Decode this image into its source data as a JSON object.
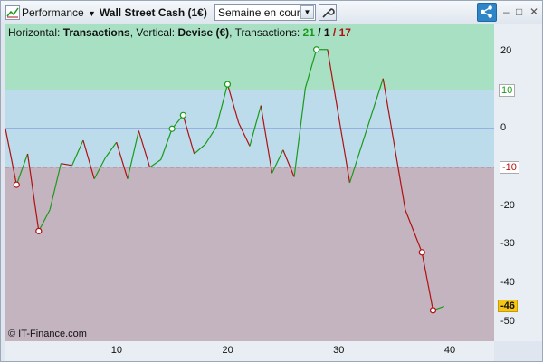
{
  "toolbar": {
    "performance_label": "Performance",
    "instrument": "Wall Street Cash (1€)",
    "period_value": "Semaine en cours",
    "window_controls": [
      "–",
      "□",
      "✕"
    ]
  },
  "legend": {
    "horizontal_prefix": "Horizontal:",
    "horizontal_value": "Transactions",
    "vertical_prefix": ", Vertical:",
    "vertical_value": "Devise (€)",
    "transactions_prefix": ", Transactions:",
    "wins": "21",
    "slash1": " / ",
    "neutral": "1",
    "slash2": " / ",
    "losses": "17"
  },
  "copyright": "© IT-Finance.com",
  "colors": {
    "green_zone": "#a8e0c4",
    "blue_zone": "#bcdcec",
    "red_zone": "#c4b4c0",
    "zero_line": "#2030c0",
    "up": "#1a9a1a",
    "down": "#b01010"
  },
  "chart_data": {
    "type": "line",
    "xlim": [
      0,
      44
    ],
    "ylim": [
      -55,
      27
    ],
    "x_ticks": [
      10,
      20,
      30,
      40
    ],
    "y_ticks": [
      20,
      10,
      0,
      -10,
      -20,
      -30,
      -40,
      -50
    ],
    "zones": {
      "upper": 10,
      "lower": -10
    },
    "current_value": -46,
    "points": [
      [
        0,
        0
      ],
      [
        1,
        -14.5
      ],
      [
        2,
        -6.5
      ],
      [
        3,
        -26.5
      ],
      [
        4,
        -21
      ],
      [
        5,
        -9
      ],
      [
        6,
        -9.5
      ],
      [
        7,
        -3
      ],
      [
        8,
        -13
      ],
      [
        9,
        -7.5
      ],
      [
        10,
        -3.5
      ],
      [
        11,
        -13
      ],
      [
        12,
        -0.5
      ],
      [
        13,
        -10
      ],
      [
        14,
        -8
      ],
      [
        15,
        0
      ],
      [
        16,
        3.5
      ],
      [
        17,
        -6.5
      ],
      [
        18,
        -4
      ],
      [
        19,
        0.5
      ],
      [
        20,
        11.5
      ],
      [
        21,
        1.5
      ],
      [
        22,
        -4.5
      ],
      [
        23,
        6
      ],
      [
        24,
        -11.5
      ],
      [
        25,
        -5.5
      ],
      [
        26,
        -12.5
      ],
      [
        27,
        10.5
      ],
      [
        28,
        20.5
      ],
      [
        29,
        20.5
      ],
      [
        31,
        -14
      ],
      [
        32,
        -5
      ],
      [
        34,
        13
      ],
      [
        36,
        -21
      ],
      [
        37.5,
        -32
      ],
      [
        38.5,
        -47
      ],
      [
        39.5,
        -46
      ]
    ],
    "markers": [
      [
        1,
        -14.5
      ],
      [
        3,
        -26.5
      ],
      [
        15,
        0
      ],
      [
        16,
        3.5
      ],
      [
        20,
        11.5
      ],
      [
        28,
        20.5
      ],
      [
        37.5,
        -32
      ],
      [
        38.5,
        -47
      ]
    ]
  }
}
